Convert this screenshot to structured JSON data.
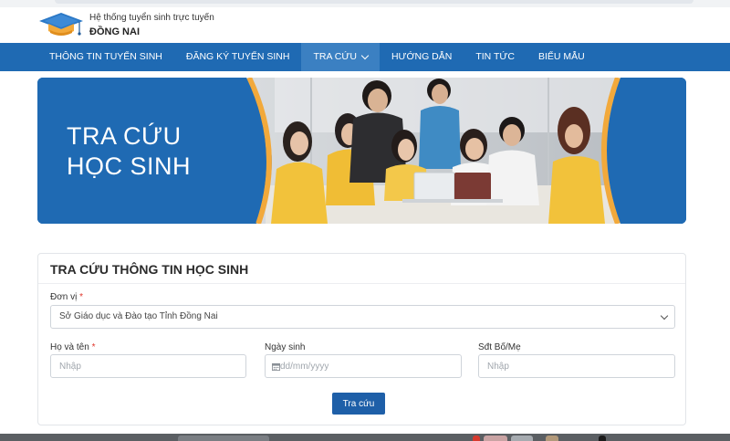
{
  "header": {
    "subtitle": "Hệ thống tuyển sinh trực tuyến",
    "title": "ĐỒNG NAI",
    "logo_icon": "graduation-cap-icon"
  },
  "nav": {
    "items": [
      {
        "label": "THÔNG TIN TUYỂN SINH",
        "active": false
      },
      {
        "label": "ĐĂNG KÝ TUYỂN SINH",
        "active": false
      },
      {
        "label": "TRA CỨU",
        "active": true
      },
      {
        "label": "HƯỚNG DẪN",
        "active": false
      },
      {
        "label": "TIN TỨC",
        "active": false
      },
      {
        "label": "BIỂU MẪU",
        "active": false
      }
    ]
  },
  "banner": {
    "line1": "TRA CỨU",
    "line2": "HỌC SINH"
  },
  "form": {
    "title": "TRA CỨU THÔNG TIN HỌC SINH",
    "unit_label": "Đơn vị",
    "unit_value": "Sở Giáo dục và Đào tạo Tỉnh Đồng Nai",
    "name_label": "Họ và tên",
    "name_placeholder": "Nhập",
    "dob_label": "Ngày sinh",
    "dob_placeholder": "dd/mm/yyyy",
    "phone_label": "Sđt Bố/Mẹ",
    "phone_placeholder": "Nhập",
    "required_mark": "*",
    "submit_label": "Tra cứu"
  },
  "colors": {
    "brand_blue": "#1f6ab3",
    "active_nav": "#3b80c2",
    "button": "#1e5fa8",
    "banner_accent": "#f2a93b",
    "required": "#e0352b"
  }
}
